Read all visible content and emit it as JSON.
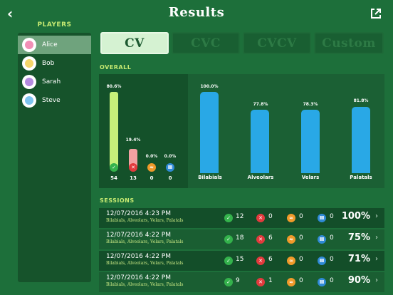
{
  "header": {
    "title": "Results",
    "back_icon": "chevron-left-icon",
    "share_icon": "share-icon"
  },
  "players": {
    "title": "PLAYERS",
    "items": [
      {
        "name": "Alice",
        "selected": true,
        "color": "#f28fb6"
      },
      {
        "name": "Bob",
        "selected": false,
        "color": "#f5d66a"
      },
      {
        "name": "Sarah",
        "selected": false,
        "color": "#b58be0"
      },
      {
        "name": "Steve",
        "selected": false,
        "color": "#7ec4ef"
      }
    ]
  },
  "tabs": [
    {
      "label": "CV",
      "active": true
    },
    {
      "label": "CVC",
      "active": false
    },
    {
      "label": "CVCV",
      "active": false
    },
    {
      "label": "Custom",
      "active": false
    }
  ],
  "overall": {
    "title": "OVERALL",
    "outcomes": [
      {
        "label": "80.6%",
        "count": "54",
        "icon": "check-icon",
        "value": 80.6,
        "color": "#c6f07a"
      },
      {
        "label": "19.4%",
        "count": "13",
        "icon": "cross-icon",
        "value": 19.4,
        "color": "#f2a1a2"
      },
      {
        "label": "0.0%",
        "count": "0",
        "icon": "approx-icon",
        "value": 0.0,
        "color": "#f09a2a"
      },
      {
        "label": "0.0%",
        "count": "0",
        "icon": "pause-icon",
        "value": 0.0,
        "color": "#2f8ad6"
      }
    ],
    "categories": [
      {
        "name": "Bilabials",
        "label": "100.0%",
        "value": 100.0
      },
      {
        "name": "Alveolars",
        "label": "77.8%",
        "value": 77.8
      },
      {
        "name": "Velars",
        "label": "78.3%",
        "value": 78.3
      },
      {
        "name": "Palatals",
        "label": "81.8%",
        "value": 81.8
      }
    ],
    "category_bar_color": "#29a8e6"
  },
  "sessions": {
    "title": "SESSIONS",
    "rows": [
      {
        "date": "12/07/2016 4:23 PM",
        "sounds": "Bilabials, Alveolars, Velars, Palatals",
        "correct": "12",
        "wrong": "0",
        "approx": "0",
        "pause": "0",
        "percent": "100%"
      },
      {
        "date": "12/07/2016 4:22 PM",
        "sounds": "Bilabials, Alveolars, Velars, Palatals",
        "correct": "18",
        "wrong": "6",
        "approx": "0",
        "pause": "0",
        "percent": "75%"
      },
      {
        "date": "12/07/2016 4:22 PM",
        "sounds": "Bilabials, Alveolars, Velars, Palatals",
        "correct": "15",
        "wrong": "6",
        "approx": "0",
        "pause": "0",
        "percent": "71%"
      },
      {
        "date": "12/07/2016 4:22 PM",
        "sounds": "Bilabials, Alveolars, Velars, Palatals",
        "correct": "9",
        "wrong": "1",
        "approx": "0",
        "pause": "0",
        "percent": "90%"
      }
    ]
  }
}
